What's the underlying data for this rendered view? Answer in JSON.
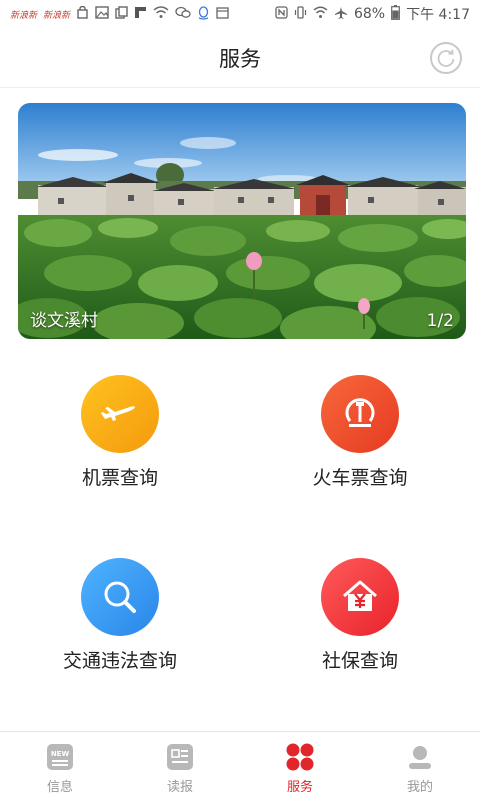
{
  "status_bar": {
    "app_icons": [
      "新浪新",
      "新浪新"
    ],
    "battery": "68%",
    "time": "下午 4:17"
  },
  "header": {
    "title": "服务"
  },
  "banner": {
    "caption": "谈文溪村",
    "counter": "1/2"
  },
  "services": [
    {
      "label": "机票查询",
      "icon": "airplane-icon",
      "color": "#f7a614"
    },
    {
      "label": "火车票查询",
      "icon": "train-icon",
      "color": "#f2542d"
    },
    {
      "label": "交通违法查询",
      "icon": "search-icon",
      "color": "#3a9cf2"
    },
    {
      "label": "社保查询",
      "icon": "house-yuan-icon",
      "color": "#f23a3a"
    }
  ],
  "bottom_nav": [
    {
      "label": "信息",
      "icon": "news-icon",
      "active": false
    },
    {
      "label": "读报",
      "icon": "newspaper-icon",
      "active": false
    },
    {
      "label": "服务",
      "icon": "services-icon",
      "active": true
    },
    {
      "label": "我的",
      "icon": "profile-icon",
      "active": false
    }
  ],
  "colors": {
    "accent": "#e0262a",
    "inactive": "#999999"
  }
}
